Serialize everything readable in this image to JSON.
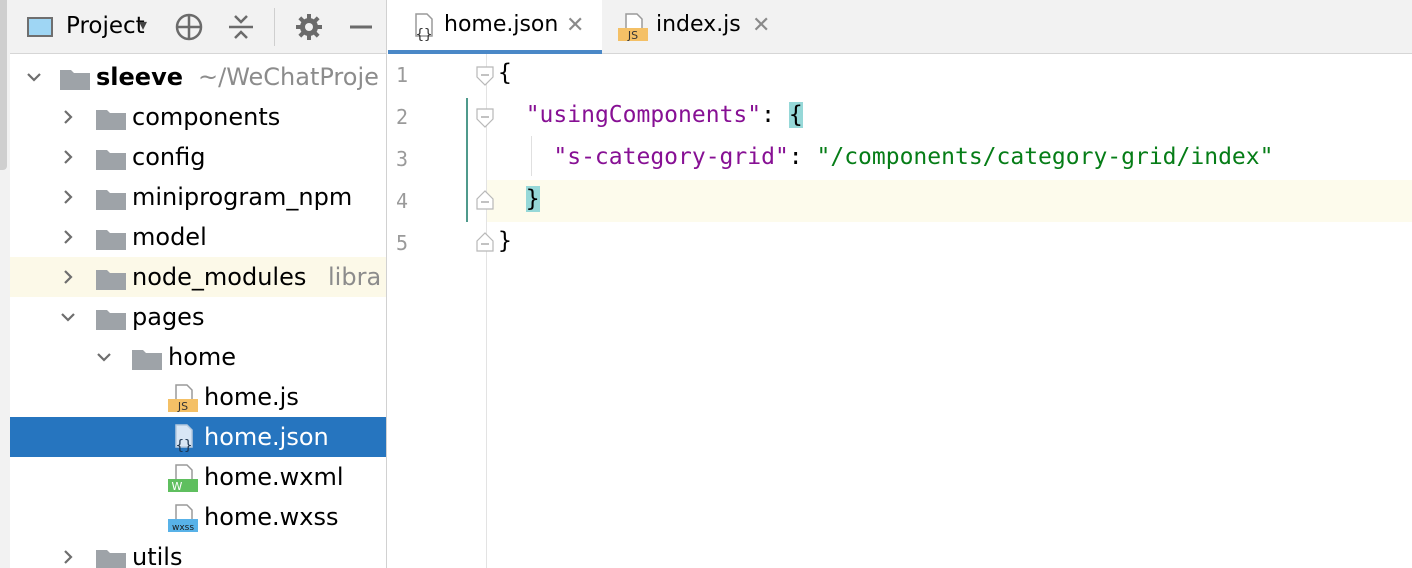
{
  "project_panel": {
    "title": "Project",
    "tree": [
      {
        "label": "sleeve",
        "sub": "~/WeChatProje"
      },
      {
        "label": "components"
      },
      {
        "label": "config"
      },
      {
        "label": "miniprogram_npm"
      },
      {
        "label": "model"
      },
      {
        "label": "node_modules",
        "sub": "libra"
      },
      {
        "label": "pages"
      },
      {
        "label": "home"
      },
      {
        "label": "home.js",
        "icon_text": "JS"
      },
      {
        "label": "home.json",
        "icon_text": "{}"
      },
      {
        "label": "home.wxml",
        "icon_text": "W"
      },
      {
        "label": "home.wxss",
        "icon_text": "wxss"
      },
      {
        "label": "utils"
      }
    ]
  },
  "tabs": [
    {
      "label": "home.json",
      "close": "✕",
      "icon_text": "{}"
    },
    {
      "label": "index.js",
      "close": "✕",
      "icon_text": "JS"
    }
  ],
  "editor": {
    "line_numbers": [
      "1",
      "2",
      "3",
      "4",
      "5"
    ],
    "code": {
      "open_brace": "{",
      "key1": "\"usingComponents\"",
      "colon1": ": ",
      "brace_open2": "{",
      "key2": "\"s-category-grid\"",
      "colon2": ": ",
      "value2": "\"/components/category-grid/index\"",
      "brace_close2": "}",
      "close_brace": "}"
    }
  },
  "colors": {
    "selection": "#2675bf",
    "key": "#871094",
    "string": "#067d17",
    "brace_match": "#96d8d8",
    "current_line": "#fdfbec"
  }
}
